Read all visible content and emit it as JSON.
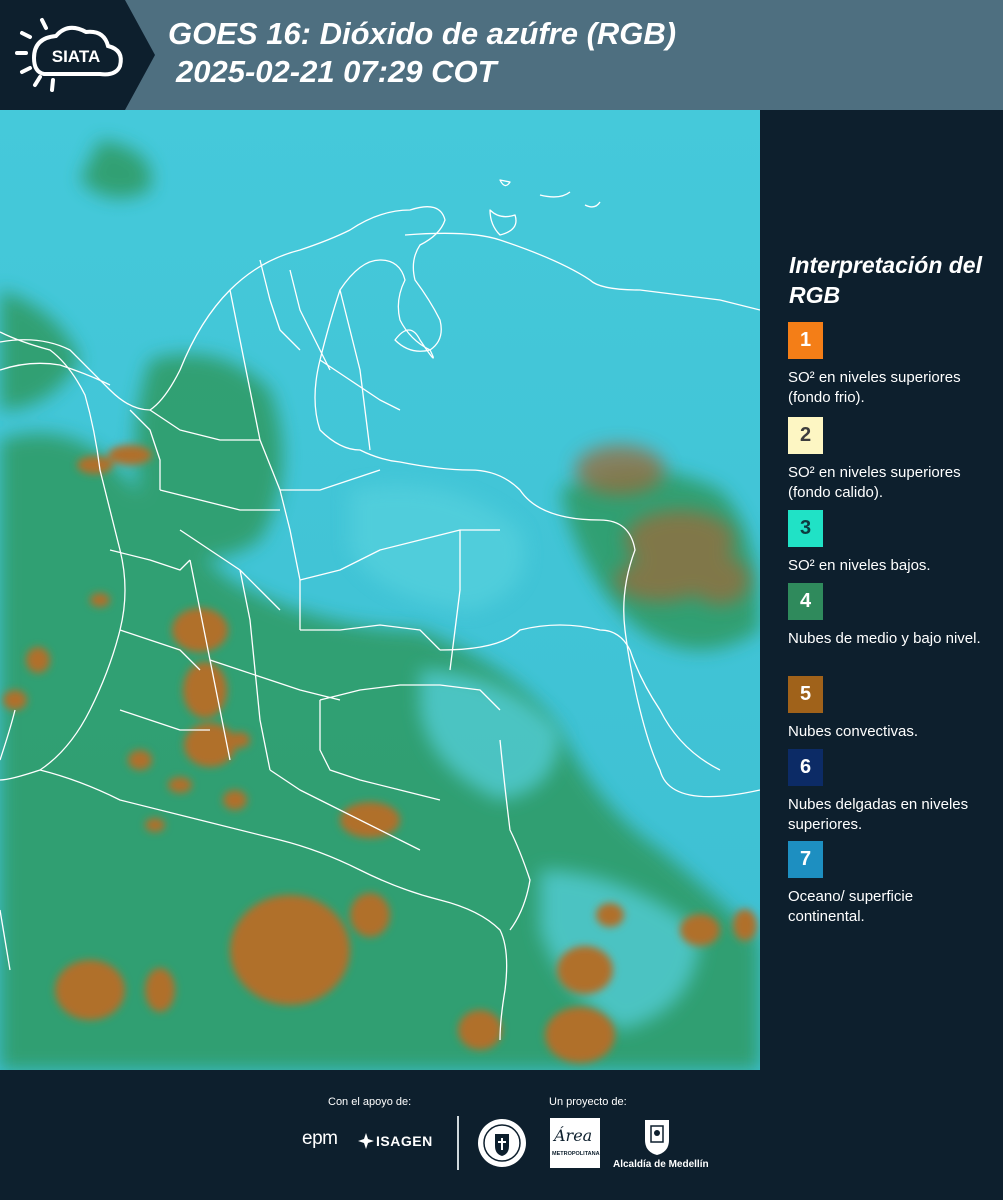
{
  "header": {
    "logo_text": "SIATA",
    "title_line1": "GOES 16: Dióxido de azúfre (RGB)",
    "title_line2": "2025-02-21 07:29 COT"
  },
  "legend": {
    "title": "Interpretación del RGB",
    "items": [
      {
        "number": "1",
        "label": "SO² en niveles superiores (fondo frio).",
        "color": "#f47e17",
        "text_color": "#ffffff"
      },
      {
        "number": "2",
        "label": "SO² en niveles superiores (fondo calido).",
        "color": "#fdf6c3",
        "text_color": "#3d3d3d"
      },
      {
        "number": "3",
        "label": "SO² en niveles bajos.",
        "color": "#20e2c6",
        "text_color": "#0d3b40"
      },
      {
        "number": "4",
        "label": "Nubes de medio y bajo nivel.",
        "color": "#2f8a5c",
        "text_color": "#ffffff"
      },
      {
        "number": "5",
        "label": "Nubes convectivas.",
        "color": "#a0621a",
        "text_color": "#ffffff"
      },
      {
        "number": "6",
        "label": "Nubes delgadas en niveles superiores.",
        "color": "#0c2b66",
        "text_color": "#ffffff"
      },
      {
        "number": "7",
        "label": "Oceano/ superficie continental.",
        "color": "#1d8fc1",
        "text_color": "#ffffff"
      }
    ]
  },
  "footer": {
    "support_caption": "Con el apoyo de:",
    "project_caption": "Un proyecto de:",
    "sponsor_epm": "epm",
    "sponsor_isagen": "ISAGEN",
    "partner_area": "Área",
    "partner_area_sub": "METROPOLITANA",
    "partner_alcaldia": "Alcaldía de Medellín"
  },
  "colors": {
    "header_bg": "#4e6f80",
    "panel_bg": "#0d1f2d",
    "ocean_cyan": "#3fc4d6",
    "land_green": "#2f8a5c",
    "convective_brown": "#a0621a"
  }
}
